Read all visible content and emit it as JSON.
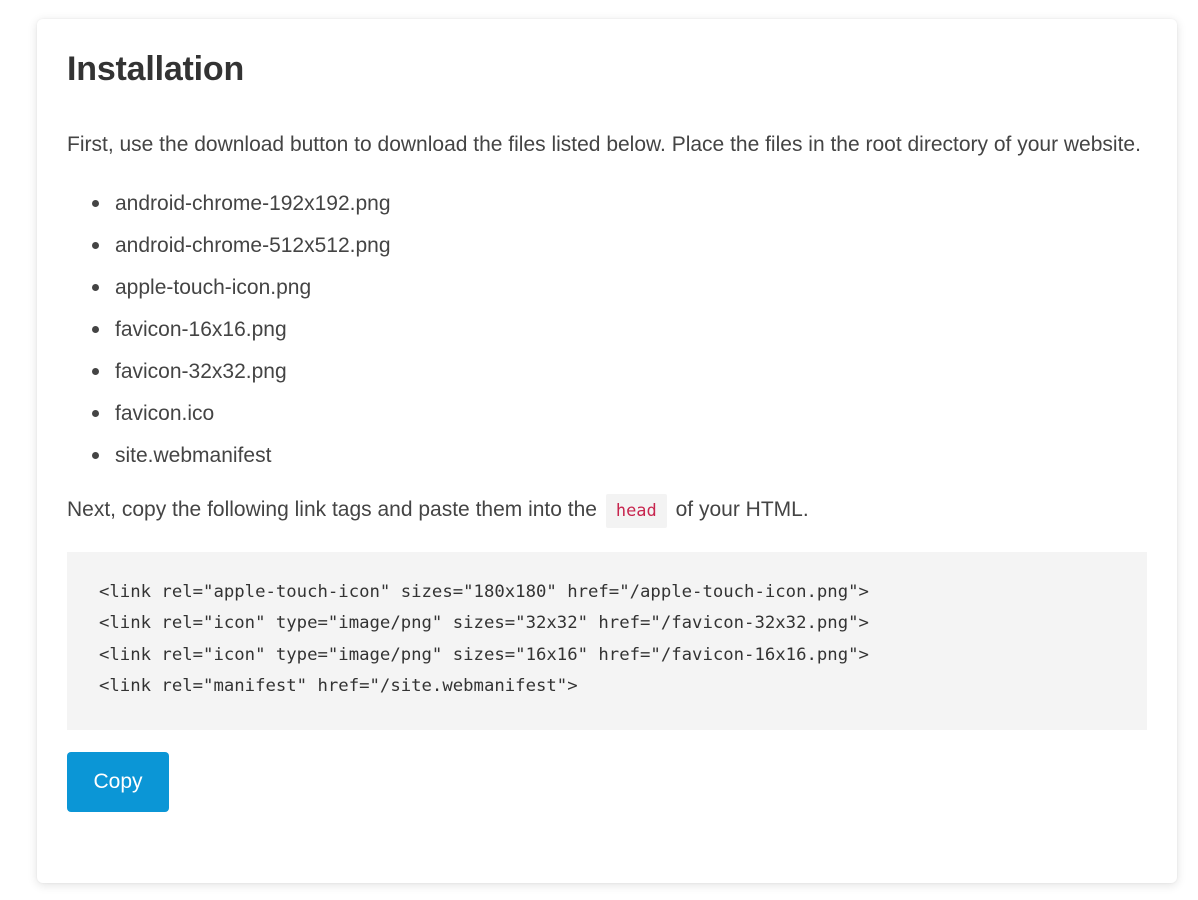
{
  "section": {
    "title": "Installation",
    "intro": "First, use the download button to download the files listed below. Place the files in the root directory of your website.",
    "files": [
      "android-chrome-192x192.png",
      "android-chrome-512x512.png",
      "apple-touch-icon.png",
      "favicon-16x16.png",
      "favicon-32x32.png",
      "favicon.ico",
      "site.webmanifest"
    ],
    "next_before": "Next, copy the following link tags and paste them into the",
    "next_code": "head",
    "next_after": "of your HTML.",
    "code_lines": [
      "<link rel=\"apple-touch-icon\" sizes=\"180x180\" href=\"/apple-touch-icon.png\">",
      "<link rel=\"icon\" type=\"image/png\" sizes=\"32x32\" href=\"/favicon-32x32.png\">",
      "<link rel=\"icon\" type=\"image/png\" sizes=\"16x16\" href=\"/favicon-16x16.png\">",
      "<link rel=\"manifest\" href=\"/site.webmanifest\">"
    ],
    "copy_label": "Copy"
  },
  "colors": {
    "button_bg": "#0b96d6",
    "inline_code": "#c7254e",
    "code_bg": "#f4f4f4"
  }
}
